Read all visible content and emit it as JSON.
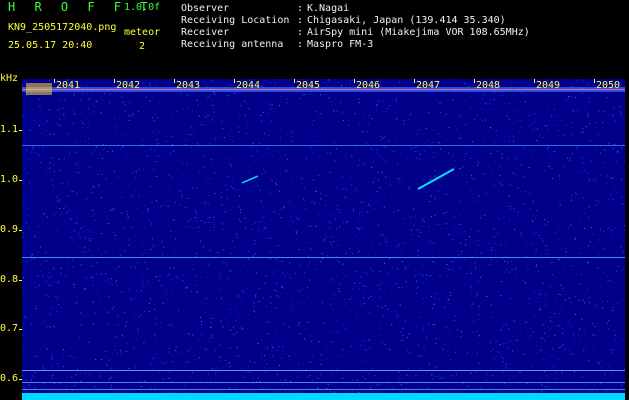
{
  "header": {
    "app_title": "H R O F F T",
    "version": "1.0.0f",
    "filename": "KN9_2505172040.png",
    "datetime": "25.05.17 20:40",
    "meteor_label": "meteor",
    "meteor_count": "2"
  },
  "info": [
    {
      "label": "Observer",
      "value": "K.Nagai"
    },
    {
      "label": "Receiving Location",
      "value": "Chigasaki, Japan (139.414 35.340)"
    },
    {
      "label": "Receiver",
      "value": "AirSpy mini (Miakejima VOR 108.65MHz)"
    },
    {
      "label": "Receiving antenna",
      "value": "Maspro FM-3"
    }
  ],
  "axes": {
    "y_unit": "kHz",
    "y_ticks": [
      "1.1",
      "1.0",
      "0.9",
      "0.8",
      "0.7",
      "0.6"
    ],
    "x_ticks": [
      "2041",
      "2042",
      "2043",
      "2044",
      "2045",
      "2046",
      "2047",
      "2048",
      "2049",
      "2050"
    ]
  },
  "colors": {
    "background": "#00008a",
    "label": "#ffff3a",
    "title": "#3aff3a",
    "signal": "#00e5ff",
    "baseline": "#00d9ff"
  }
}
